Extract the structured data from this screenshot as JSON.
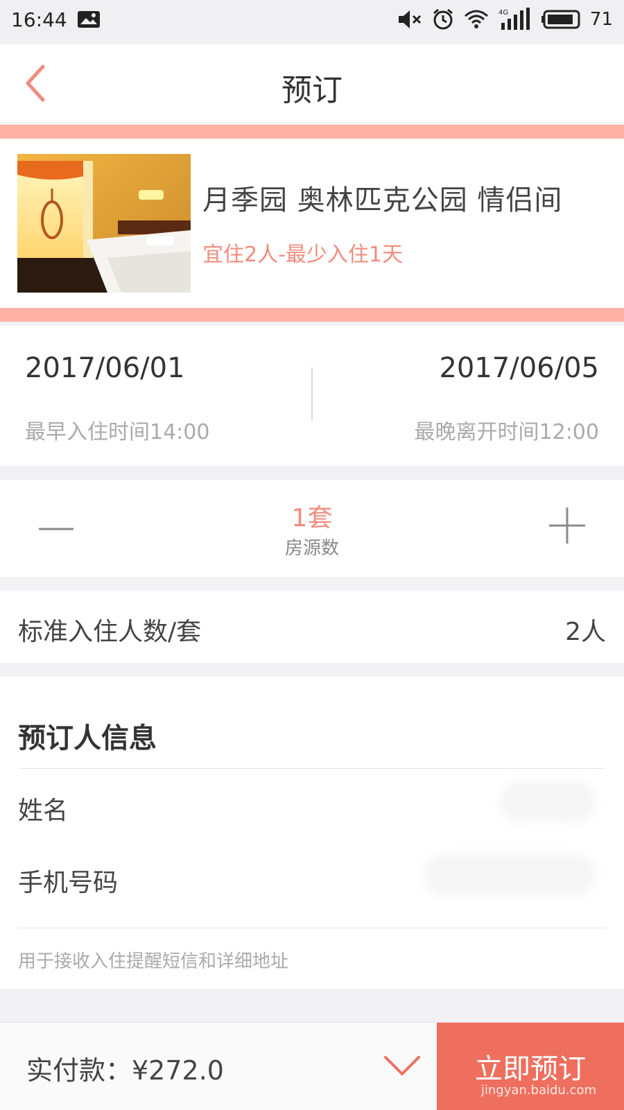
{
  "status_bar": {
    "time": "16:44",
    "battery": "71",
    "network": "4G",
    "icons": [
      "image-notification-icon",
      "mute-icon",
      "alarm-icon",
      "wifi-icon",
      "signal-icon",
      "battery-icon"
    ]
  },
  "header": {
    "title": "预订",
    "back_icon": "back-arrow-icon"
  },
  "room": {
    "name": "月季园 奥林匹克公园 情侣间",
    "subtitle": "宜住2人-最少入住1天"
  },
  "dates": {
    "checkin_date": "2017/06/01",
    "checkout_date": "2017/06/05",
    "checkin_hint": "最早入住时间14:00",
    "checkout_hint": "最晚离开时间12:00"
  },
  "rooms_selector": {
    "count": "1套",
    "label": "房源数",
    "minus_icon": "minus-icon",
    "plus_icon": "plus-icon"
  },
  "occupancy": {
    "label": "标准入住人数/套",
    "value": "2人"
  },
  "booker": {
    "title": "预订人信息",
    "name_label": "姓名",
    "phone_label": "手机号码",
    "note": "用于接收入住提醒短信和详细地址"
  },
  "bottom_bar": {
    "pay_label": "实付款：¥272.0",
    "submit_label": "立即预订",
    "watermark": "jingyan.baidu.com"
  },
  "colors": {
    "accent": "#f08c7e",
    "band": "#ffb1a6",
    "submit": "#ef6f5e"
  }
}
